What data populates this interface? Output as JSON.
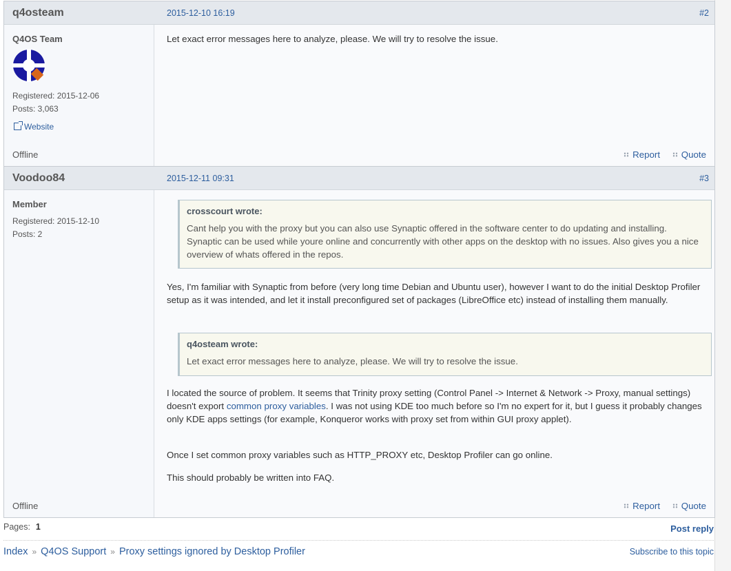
{
  "posts": [
    {
      "author": "q4osteam",
      "date": "2015-12-10 16:19",
      "number": "#2",
      "rank": "Q4OS Team",
      "registered": "Registered: 2015-12-06",
      "posts": "Posts: 3,063",
      "website": "Website",
      "status": "Offline",
      "message": "Let exact error messages here to analyze, please. We will try to resolve the issue.",
      "report": "Report",
      "quote": "Quote"
    },
    {
      "author": "Voodoo84",
      "date": "2015-12-11 09:31",
      "number": "#3",
      "rank": "Member",
      "registered": "Registered: 2015-12-10",
      "posts": "Posts: 2",
      "status": "Offline",
      "quote1_author": "crosscourt wrote:",
      "quote1_text": "Cant help you with the proxy but you can also use Synaptic offered in the software center to do updating and installing. Synaptic can be used while youre online and concurrently with other apps on the desktop with no issues. Also gives you a nice overview of whats offered in the repos.",
      "para1": "Yes, I'm familiar with Synaptic from before (very long time Debian and Ubuntu user), however I want to do the initial Desktop Profiler setup as it was intended, and let it install preconfigured set of packages (LibreOffice etc) instead of installing them manually.",
      "quote2_author": "q4osteam wrote:",
      "quote2_text": "Let exact error messages here to analyze, please. We will try to resolve the issue.",
      "para2_a": "I located the source of problem. It seems that Trinity proxy setting (Control Panel -> Internet & Network -> Proxy, manual settings) doesn't export ",
      "para2_link": "common proxy variables",
      "para2_b": ". I was not using KDE too much before so I'm no expert for it, but I guess it probably changes only KDE apps settings (for example, Konqueror works with proxy set from within GUI proxy applet).",
      "para3": "Once I set common proxy variables such as HTTP_PROXY etc, Desktop Profiler can go online.",
      "para4": "This should probably be written into FAQ.",
      "report": "Report",
      "quote": "Quote"
    }
  ],
  "pagination": {
    "label": "Pages:",
    "current": "1"
  },
  "post_reply": "Post reply",
  "breadcrumb": {
    "index": "Index",
    "forum": "Q4OS Support",
    "topic": "Proxy settings ignored by Desktop Profiler",
    "separator": "»"
  },
  "subscribe": "Subscribe to this topic",
  "colors": {
    "link": "#2d5e9e",
    "header_bg": "#e4e8ed",
    "quote_bg": "#f8f8ee"
  }
}
